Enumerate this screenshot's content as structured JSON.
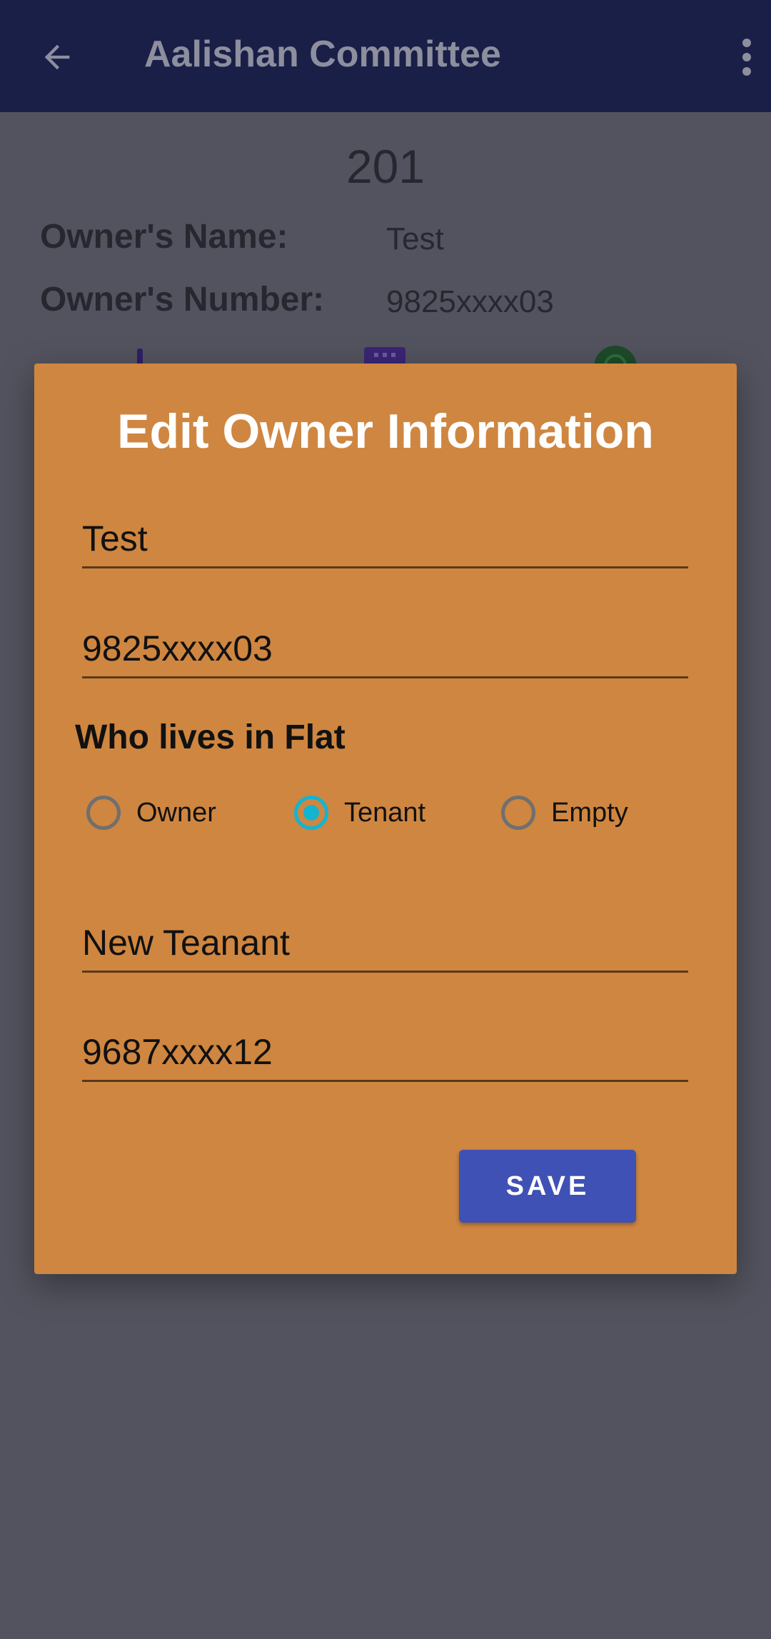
{
  "toolbar": {
    "title": "Aalishan Committee",
    "back_icon": "arrow-back-icon",
    "more_icon": "more-vert-icon"
  },
  "flat": {
    "number": "201",
    "owner_name_label": "Owner's Name:",
    "owner_name_value": "Test",
    "owner_number_label": "Owner's Number:",
    "owner_number_value": "9825xxxx03",
    "action_icons": [
      "phone-icon",
      "message-icon",
      "whatsapp-icon"
    ]
  },
  "dialog": {
    "title": "Edit Owner Information",
    "owner_name": "Test",
    "owner_number": "9825xxxx03",
    "who_lives_label": "Who lives in Flat",
    "options": [
      {
        "label": "Owner",
        "checked": false
      },
      {
        "label": "Tenant",
        "checked": true
      },
      {
        "label": "Empty",
        "checked": false
      }
    ],
    "tenant_name": "New Teanant",
    "tenant_number": "9687xxxx12",
    "save_label": "SAVE"
  },
  "colors": {
    "toolbar": "#1a1f48",
    "dialog": "#cf8640",
    "accent": "#13b4d1",
    "save_button": "#3f51b5"
  }
}
